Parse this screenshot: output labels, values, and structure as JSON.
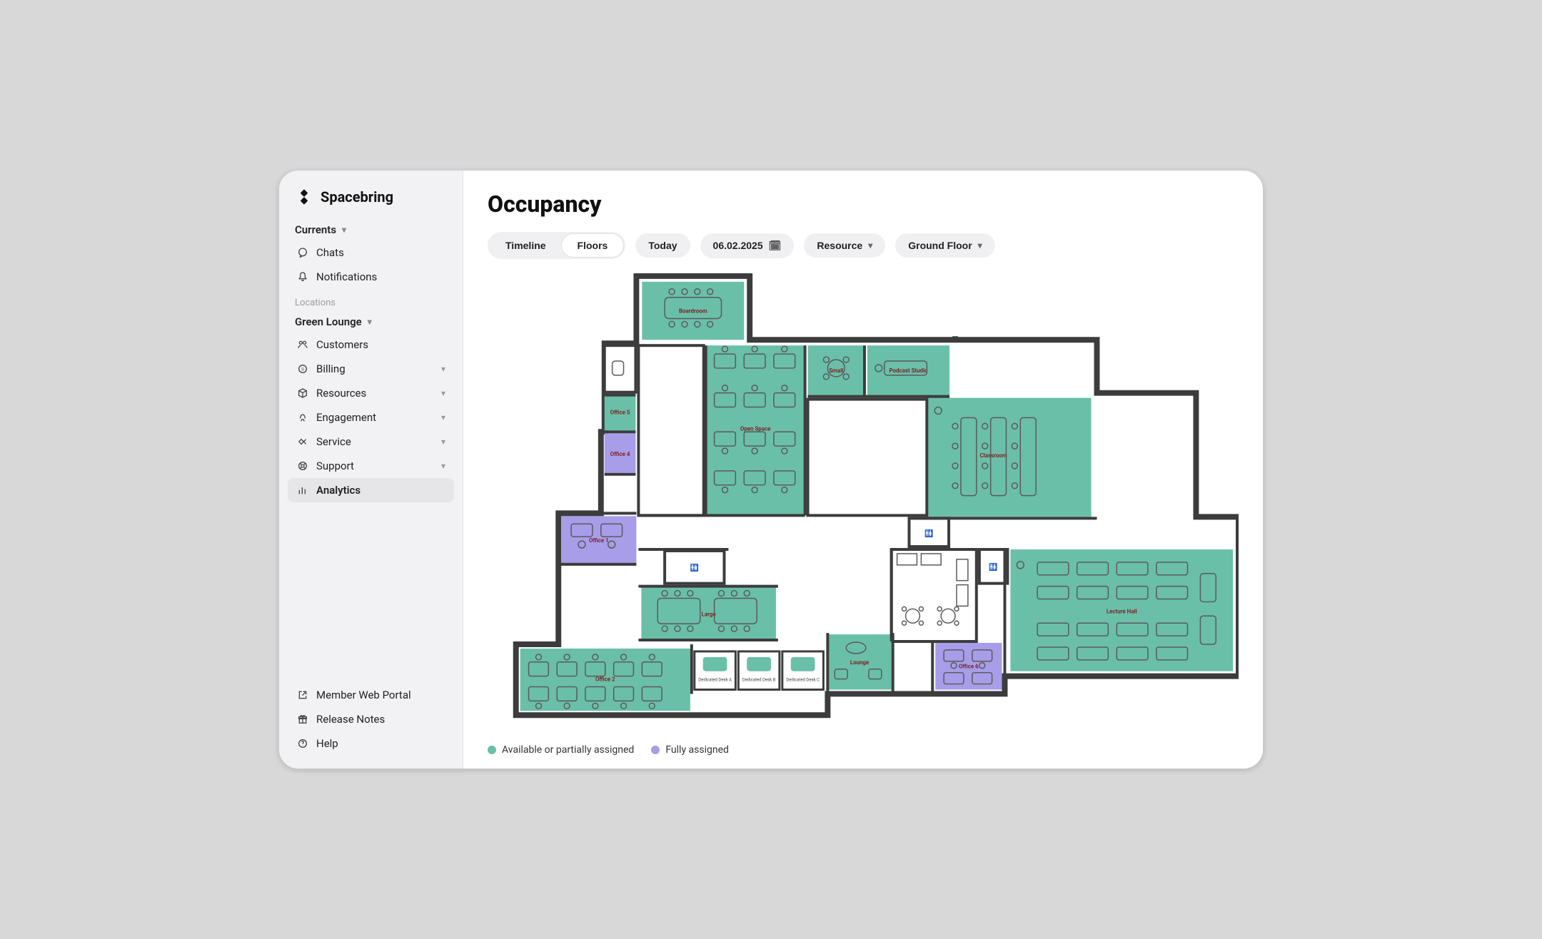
{
  "brand": {
    "name": "Spacebring"
  },
  "sidebar": {
    "top_group": {
      "label": "Currents"
    },
    "top_items": [
      {
        "label": "Chats",
        "icon": "chat"
      },
      {
        "label": "Notifications",
        "icon": "bell"
      }
    ],
    "locations_label": "Locations",
    "location_group": {
      "label": "Green Lounge"
    },
    "location_items": [
      {
        "label": "Customers",
        "icon": "users",
        "chev": false
      },
      {
        "label": "Billing",
        "icon": "currency",
        "chev": true
      },
      {
        "label": "Resources",
        "icon": "cube",
        "chev": true
      },
      {
        "label": "Engagement",
        "icon": "wave",
        "chev": true
      },
      {
        "label": "Service",
        "icon": "handshake",
        "chev": true
      },
      {
        "label": "Support",
        "icon": "lifebuoy",
        "chev": true
      },
      {
        "label": "Analytics",
        "icon": "bars",
        "chev": false,
        "active": true
      }
    ],
    "footer_items": [
      {
        "label": "Member Web Portal",
        "icon": "external"
      },
      {
        "label": "Release Notes",
        "icon": "gift"
      },
      {
        "label": "Help",
        "icon": "help"
      }
    ]
  },
  "page": {
    "title": "Occupancy"
  },
  "toolbar": {
    "seg": {
      "a": "Timeline",
      "b": "Floors",
      "active": "b"
    },
    "today": "Today",
    "date": "06.02.2025",
    "resource": "Resource",
    "floor": "Ground Floor"
  },
  "legend": {
    "available": "Available or partially assigned",
    "full": "Fully assigned"
  },
  "colors": {
    "available": "#6abfa8",
    "full": "#a79de8"
  },
  "rooms": [
    {
      "name": "Boardroom",
      "status": "available"
    },
    {
      "name": "Open Space",
      "status": "available"
    },
    {
      "name": "Small",
      "status": "available"
    },
    {
      "name": "Podcast Studio",
      "status": "available"
    },
    {
      "name": "Classroom",
      "status": "available"
    },
    {
      "name": "Office 5",
      "status": "available"
    },
    {
      "name": "Office 4",
      "status": "full"
    },
    {
      "name": "Office 1",
      "status": "full"
    },
    {
      "name": "Large",
      "status": "available"
    },
    {
      "name": "Lounge",
      "status": "available"
    },
    {
      "name": "Office 2",
      "status": "available"
    },
    {
      "name": "Office 6",
      "status": "full"
    },
    {
      "name": "Lecture Hall",
      "status": "available"
    },
    {
      "name": "Dedicated Desk A",
      "status": "available"
    },
    {
      "name": "Dedicated Desk B",
      "status": "available"
    },
    {
      "name": "Dedicated Desk C",
      "status": "available"
    }
  ]
}
